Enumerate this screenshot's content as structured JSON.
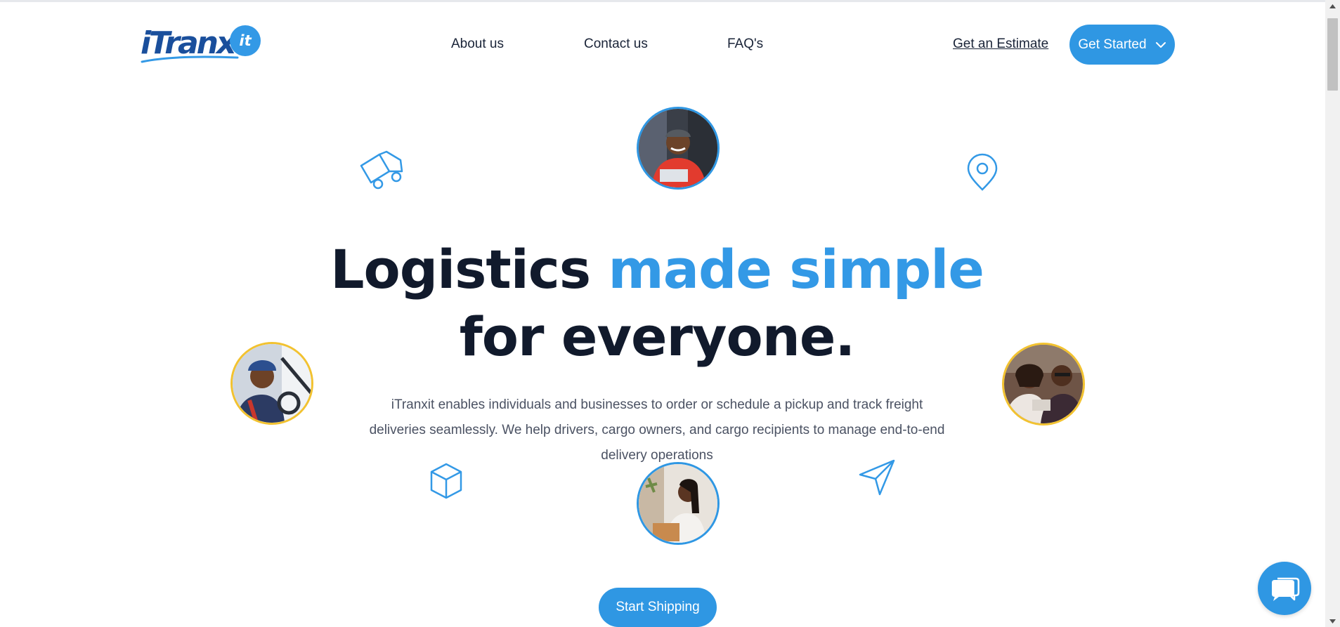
{
  "header": {
    "logo_text": "iTranx",
    "logo_badge": "it",
    "nav": [
      {
        "label": "About us"
      },
      {
        "label": "Contact us"
      },
      {
        "label": "FAQ's"
      }
    ],
    "estimate_label": "Get an Estimate",
    "get_started_label": "Get Started"
  },
  "hero": {
    "title_part1": "Logistics",
    "title_accent": "made simple",
    "title_part2": "for everyone.",
    "subtitle": "iTranxit enables individuals and businesses to order or schedule a pickup and track freight deliveries seamlessly. We help drivers, cargo owners, and cargo recipients to manage end-to-end delivery operations",
    "cta_label": "Start Shipping"
  },
  "colors": {
    "accent": "#3399e6",
    "button": "#2f97e3",
    "heading": "#111a2c",
    "body": "#4b5263",
    "avatar_ring_gold": "#f2c230"
  },
  "icons": {
    "truck": "truck-icon",
    "location": "location-pin-icon",
    "box": "box-icon",
    "send": "paper-plane-icon",
    "chat": "chat-icon",
    "chevron": "chevron-down-icon"
  }
}
